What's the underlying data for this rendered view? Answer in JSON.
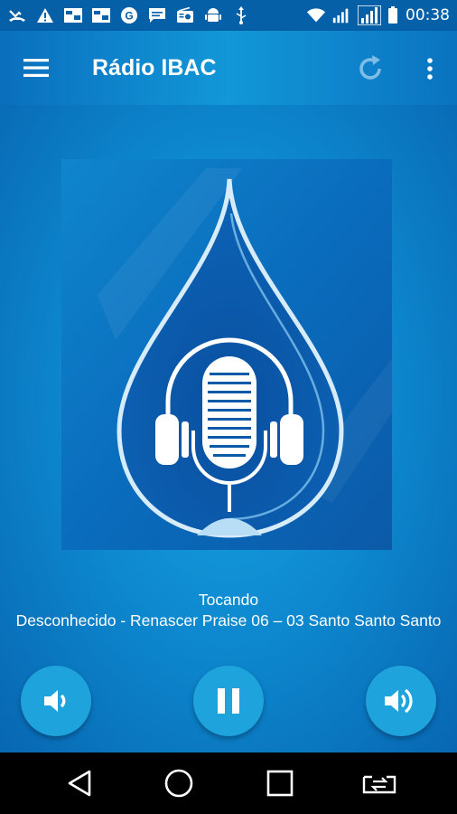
{
  "status_bar": {
    "time": "00:38",
    "icons": [
      "missed-call-icon",
      "warning-icon",
      "message-icon",
      "message-icon",
      "gear-icon",
      "chat-icon",
      "radio-icon",
      "android-icon",
      "usb-icon",
      "wifi-icon",
      "signal-icon",
      "signal-icon",
      "battery-icon"
    ]
  },
  "app_bar": {
    "title": "Rádio IBAC"
  },
  "player": {
    "status": "Tocando",
    "track": "Desconhecido - Renascer Praise 06 – 03 Santo Santo Santo"
  },
  "colors": {
    "accent": "#1fa3dc",
    "background": "#0d7fc4",
    "status_bar": "#0560a8"
  }
}
